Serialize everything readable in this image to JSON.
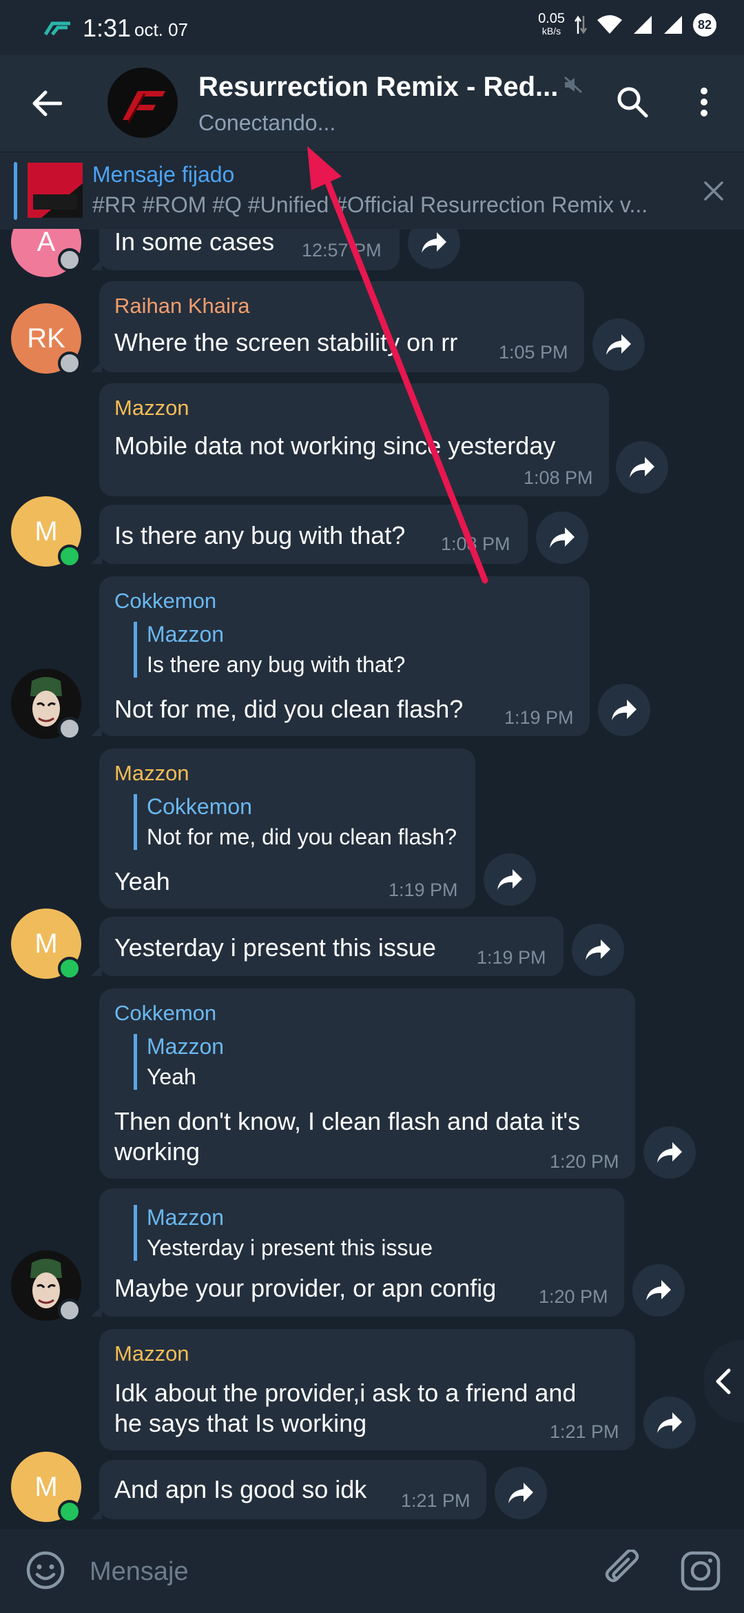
{
  "status_bar": {
    "time": "1:31",
    "date": "oct. 07",
    "speed": "0.05",
    "speed_unit": "kB/s",
    "battery": "82"
  },
  "header": {
    "title": "Resurrection Remix - Red...",
    "status": "Conectando..."
  },
  "pinned": {
    "title": "Mensaje fijado",
    "text": "#RR #ROM #Q #Unified #Official Resurrection Remix v..."
  },
  "messages": [
    {
      "avatar": "A",
      "text": "In some cases",
      "time": "12:57 PM"
    },
    {
      "avatar": "RK",
      "sender": "Raihan Khaira",
      "text": "Where the screen stability on rr",
      "time": "1:05 PM"
    },
    {
      "sender": "Mazzon",
      "text": "Mobile data not working since yesterday",
      "time": "1:08 PM"
    },
    {
      "avatar": "M",
      "text": "Is there any bug with that?",
      "time": "1:08 PM"
    },
    {
      "sender": "Cokkemon",
      "reply_name": "Mazzon",
      "reply_text": "Is there any bug with that?",
      "text": "Not for me, did you clean flash?",
      "time": "1:19 PM"
    },
    {
      "sender": "Mazzon",
      "reply_name": "Cokkemon",
      "reply_text": "Not for me, did you clean flash?",
      "text": "Yeah",
      "time": "1:19 PM"
    },
    {
      "avatar": "M",
      "text": "Yesterday i present this issue",
      "time": "1:19 PM"
    },
    {
      "sender": "Cokkemon",
      "reply_name": "Mazzon",
      "reply_text": "Yeah",
      "text_line1": "Then don't know, I clean flash and data it's",
      "text_line2": "working",
      "time": "1:20 PM"
    },
    {
      "reply_name": "Mazzon",
      "reply_text": "Yesterday i present this issue",
      "text": "Maybe your provider, or apn config",
      "time": "1:20 PM"
    },
    {
      "sender": "Mazzon",
      "text_line1": "Idk about the provider,i ask to a friend and",
      "text_line2": "he says that Is working",
      "time": "1:21 PM"
    },
    {
      "avatar": "M",
      "text": "And apn Is good so idk",
      "time": "1:21 PM"
    }
  ],
  "composer": {
    "placeholder": "Mensaje"
  },
  "colors": {
    "background": "#18222d",
    "bubble": "#242f3d",
    "header": "#222e3a",
    "accent_blue": "#4ea4f6",
    "mazzon_name": "#f4bd56",
    "cokkemon_name": "#6ab8f0",
    "raihan_name": "#f29d6c",
    "annotation_arrow": "#e8174f"
  }
}
